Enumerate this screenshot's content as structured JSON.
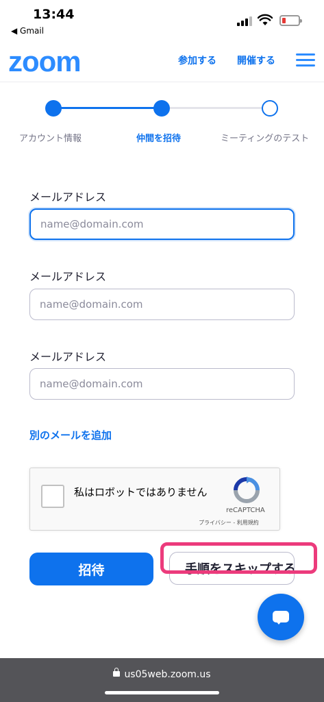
{
  "status_bar": {
    "time": "13:44",
    "back_app": "◀ Gmail",
    "battery_color": "#e53935"
  },
  "header": {
    "logo": "zoom",
    "join_label": "参加する",
    "host_label": "開催する",
    "menu_icon": "hamburger-icon",
    "brand_color": "#2d8cff"
  },
  "stepper": {
    "steps": [
      {
        "label": "アカウント情報",
        "state": "done"
      },
      {
        "label": "仲間を招待",
        "state": "current"
      },
      {
        "label": "ミーティングのテスト",
        "state": "todo"
      }
    ]
  },
  "form": {
    "fields": [
      {
        "label": "メールアドレス",
        "placeholder": "name@domain.com",
        "value": ""
      },
      {
        "label": "メールアドレス",
        "placeholder": "name@domain.com",
        "value": ""
      },
      {
        "label": "メールアドレス",
        "placeholder": "name@domain.com",
        "value": ""
      }
    ],
    "add_email_label": "別のメールを追加"
  },
  "recaptcha": {
    "checkbox_text": "私はロボットではありません",
    "brand": "reCAPTCHA",
    "links": "プライバシー - 利用規約"
  },
  "actions": {
    "invite_label": "招待",
    "skip_label": "手順をスキップする",
    "accent_color": "#0e72ed",
    "highlight_color": "#ec3b7c",
    "chat_icon": "chat-bubble-icon"
  },
  "browser": {
    "url": "us05web.zoom.us"
  }
}
